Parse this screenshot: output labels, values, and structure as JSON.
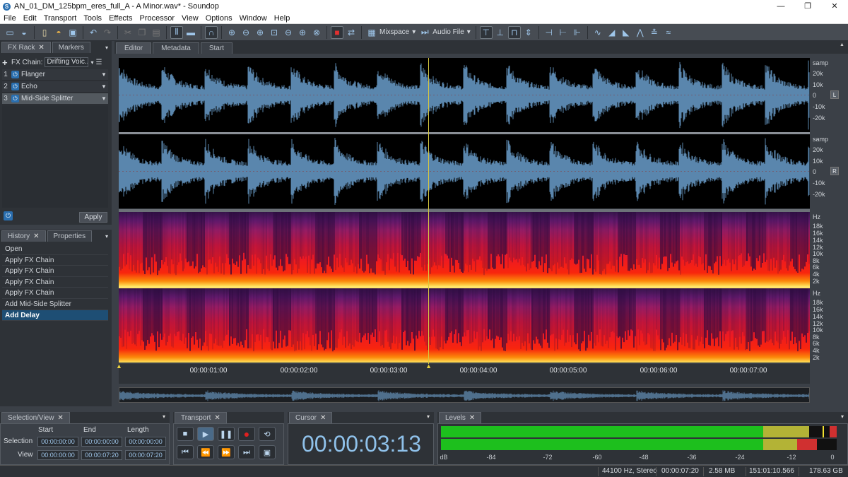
{
  "window": {
    "title": "AN_01_DM_125bpm_eres_full_A - A Minor.wav* - Soundop",
    "buttons": [
      "—",
      "❐",
      "✕"
    ]
  },
  "menu": [
    "File",
    "Edit",
    "Transport",
    "Tools",
    "Effects",
    "Processor",
    "View",
    "Options",
    "Window",
    "Help"
  ],
  "toolbar": {
    "workspace_label": "Mixspace",
    "audiofile_label": "Audio File"
  },
  "fx_panel": {
    "tabs": [
      "FX Rack",
      "Markers"
    ],
    "chain_label": "FX Chain:",
    "chain_value": "Drifting Voic...",
    "items": [
      {
        "num": "1",
        "name": "Flanger"
      },
      {
        "num": "2",
        "name": "Echo"
      },
      {
        "num": "3",
        "name": "Mid-Side Splitter"
      }
    ],
    "apply_label": "Apply"
  },
  "history_panel": {
    "tabs": [
      "History",
      "Properties"
    ],
    "items": [
      "Open",
      "Apply FX Chain",
      "Apply FX Chain",
      "Apply FX Chain",
      "Apply FX Chain",
      "Add Mid-Side Splitter",
      "Add Delay"
    ],
    "selected_index": 6
  },
  "editor": {
    "tabs": [
      "Editor",
      "Metadata",
      "Start"
    ],
    "wave_scale": [
      "samp",
      "20k",
      "10k",
      "0",
      "-10k",
      "-20k"
    ],
    "spec_scale": [
      "Hz",
      "18k",
      "16k",
      "14k",
      "12k",
      "10k",
      "8k",
      "6k",
      "4k",
      "2k"
    ],
    "channel_left": "L",
    "channel_right": "R",
    "ruler": [
      "00:00:01:00",
      "00:00:02:00",
      "00:00:03:00",
      "00:00:04:00",
      "00:00:05:00",
      "00:00:06:00",
      "00:00:07:00"
    ],
    "playhead_fraction": 0.448
  },
  "selection_view": {
    "tab": "Selection/View",
    "headers": [
      "Start",
      "End",
      "Length"
    ],
    "selection_label": "Selection",
    "view_label": "View",
    "selection": [
      "00:00:00:00",
      "00:00:00:00",
      "00:00:00:00"
    ],
    "view": [
      "00:00:00:00",
      "00:00:07:20",
      "00:00:07:20"
    ]
  },
  "transport": {
    "tab": "Transport"
  },
  "cursor": {
    "tab": "Cursor",
    "time": "00:00:03:13"
  },
  "levels": {
    "tab": "Levels",
    "scale": [
      "dB",
      "-84",
      "-72",
      "-60",
      "-48",
      "-36",
      "-24",
      "-12",
      "0"
    ],
    "left_level_fraction": 0.93,
    "right_level_fraction": 0.95
  },
  "status": {
    "format": "44100 Hz, Stereo",
    "duration": "00:00:07:20",
    "size": "2.58 MB",
    "position": "151:01:10.566",
    "free": "178.63 GB"
  },
  "colors": {
    "accent": "#2a6fb0",
    "waveform": "#5a86ad",
    "cursor_text": "#8fc1ea",
    "selected": "#1e4e74"
  }
}
